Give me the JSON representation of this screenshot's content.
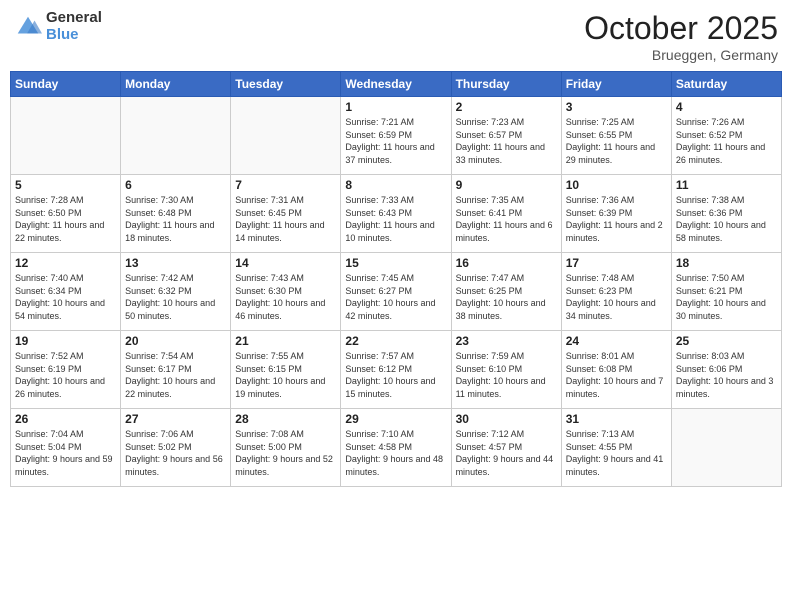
{
  "header": {
    "logo_general": "General",
    "logo_blue": "Blue",
    "month": "October 2025",
    "location": "Brueggen, Germany"
  },
  "days_of_week": [
    "Sunday",
    "Monday",
    "Tuesday",
    "Wednesday",
    "Thursday",
    "Friday",
    "Saturday"
  ],
  "weeks": [
    [
      {
        "day": "",
        "info": ""
      },
      {
        "day": "",
        "info": ""
      },
      {
        "day": "",
        "info": ""
      },
      {
        "day": "1",
        "info": "Sunrise: 7:21 AM\nSunset: 6:59 PM\nDaylight: 11 hours\nand 37 minutes."
      },
      {
        "day": "2",
        "info": "Sunrise: 7:23 AM\nSunset: 6:57 PM\nDaylight: 11 hours\nand 33 minutes."
      },
      {
        "day": "3",
        "info": "Sunrise: 7:25 AM\nSunset: 6:55 PM\nDaylight: 11 hours\nand 29 minutes."
      },
      {
        "day": "4",
        "info": "Sunrise: 7:26 AM\nSunset: 6:52 PM\nDaylight: 11 hours\nand 26 minutes."
      }
    ],
    [
      {
        "day": "5",
        "info": "Sunrise: 7:28 AM\nSunset: 6:50 PM\nDaylight: 11 hours\nand 22 minutes."
      },
      {
        "day": "6",
        "info": "Sunrise: 7:30 AM\nSunset: 6:48 PM\nDaylight: 11 hours\nand 18 minutes."
      },
      {
        "day": "7",
        "info": "Sunrise: 7:31 AM\nSunset: 6:45 PM\nDaylight: 11 hours\nand 14 minutes."
      },
      {
        "day": "8",
        "info": "Sunrise: 7:33 AM\nSunset: 6:43 PM\nDaylight: 11 hours\nand 10 minutes."
      },
      {
        "day": "9",
        "info": "Sunrise: 7:35 AM\nSunset: 6:41 PM\nDaylight: 11 hours\nand 6 minutes."
      },
      {
        "day": "10",
        "info": "Sunrise: 7:36 AM\nSunset: 6:39 PM\nDaylight: 11 hours\nand 2 minutes."
      },
      {
        "day": "11",
        "info": "Sunrise: 7:38 AM\nSunset: 6:36 PM\nDaylight: 10 hours\nand 58 minutes."
      }
    ],
    [
      {
        "day": "12",
        "info": "Sunrise: 7:40 AM\nSunset: 6:34 PM\nDaylight: 10 hours\nand 54 minutes."
      },
      {
        "day": "13",
        "info": "Sunrise: 7:42 AM\nSunset: 6:32 PM\nDaylight: 10 hours\nand 50 minutes."
      },
      {
        "day": "14",
        "info": "Sunrise: 7:43 AM\nSunset: 6:30 PM\nDaylight: 10 hours\nand 46 minutes."
      },
      {
        "day": "15",
        "info": "Sunrise: 7:45 AM\nSunset: 6:27 PM\nDaylight: 10 hours\nand 42 minutes."
      },
      {
        "day": "16",
        "info": "Sunrise: 7:47 AM\nSunset: 6:25 PM\nDaylight: 10 hours\nand 38 minutes."
      },
      {
        "day": "17",
        "info": "Sunrise: 7:48 AM\nSunset: 6:23 PM\nDaylight: 10 hours\nand 34 minutes."
      },
      {
        "day": "18",
        "info": "Sunrise: 7:50 AM\nSunset: 6:21 PM\nDaylight: 10 hours\nand 30 minutes."
      }
    ],
    [
      {
        "day": "19",
        "info": "Sunrise: 7:52 AM\nSunset: 6:19 PM\nDaylight: 10 hours\nand 26 minutes."
      },
      {
        "day": "20",
        "info": "Sunrise: 7:54 AM\nSunset: 6:17 PM\nDaylight: 10 hours\nand 22 minutes."
      },
      {
        "day": "21",
        "info": "Sunrise: 7:55 AM\nSunset: 6:15 PM\nDaylight: 10 hours\nand 19 minutes."
      },
      {
        "day": "22",
        "info": "Sunrise: 7:57 AM\nSunset: 6:12 PM\nDaylight: 10 hours\nand 15 minutes."
      },
      {
        "day": "23",
        "info": "Sunrise: 7:59 AM\nSunset: 6:10 PM\nDaylight: 10 hours\nand 11 minutes."
      },
      {
        "day": "24",
        "info": "Sunrise: 8:01 AM\nSunset: 6:08 PM\nDaylight: 10 hours\nand 7 minutes."
      },
      {
        "day": "25",
        "info": "Sunrise: 8:03 AM\nSunset: 6:06 PM\nDaylight: 10 hours\nand 3 minutes."
      }
    ],
    [
      {
        "day": "26",
        "info": "Sunrise: 7:04 AM\nSunset: 5:04 PM\nDaylight: 9 hours\nand 59 minutes."
      },
      {
        "day": "27",
        "info": "Sunrise: 7:06 AM\nSunset: 5:02 PM\nDaylight: 9 hours\nand 56 minutes."
      },
      {
        "day": "28",
        "info": "Sunrise: 7:08 AM\nSunset: 5:00 PM\nDaylight: 9 hours\nand 52 minutes."
      },
      {
        "day": "29",
        "info": "Sunrise: 7:10 AM\nSunset: 4:58 PM\nDaylight: 9 hours\nand 48 minutes."
      },
      {
        "day": "30",
        "info": "Sunrise: 7:12 AM\nSunset: 4:57 PM\nDaylight: 9 hours\nand 44 minutes."
      },
      {
        "day": "31",
        "info": "Sunrise: 7:13 AM\nSunset: 4:55 PM\nDaylight: 9 hours\nand 41 minutes."
      },
      {
        "day": "",
        "info": ""
      }
    ]
  ]
}
